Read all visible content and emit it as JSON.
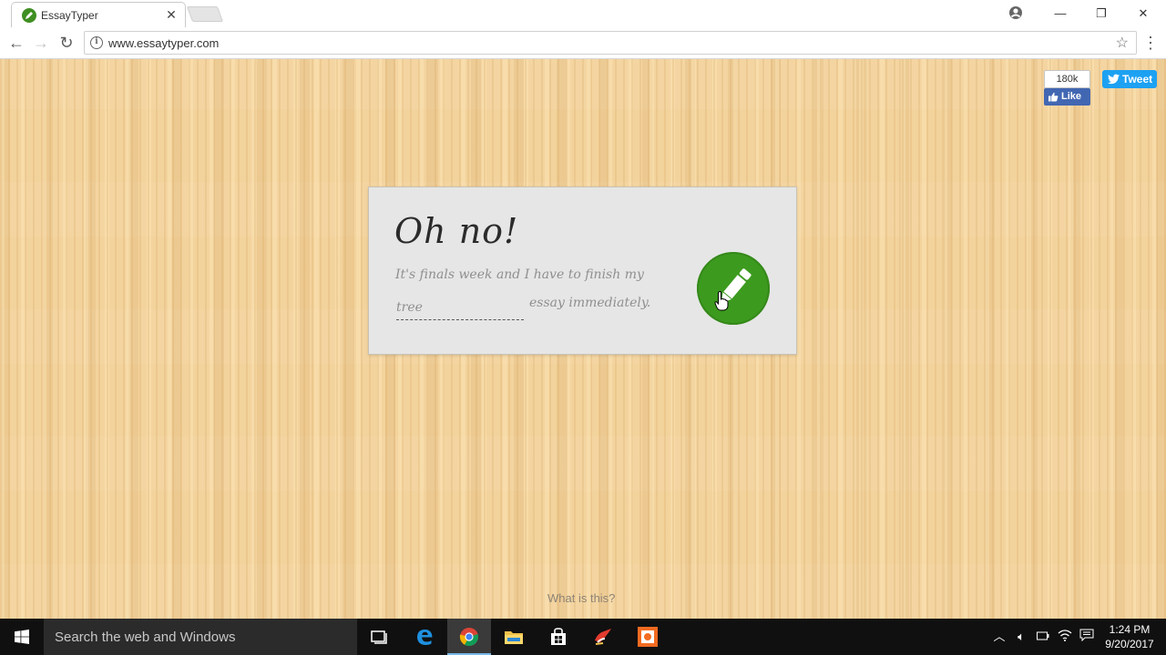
{
  "browser": {
    "tab_title": "EssayTyper",
    "tab_close": "✕",
    "url": "www.essaytyper.com",
    "window_controls": {
      "minimize": "—",
      "restore": "❐",
      "close": "✕"
    }
  },
  "social": {
    "like_count": "180k",
    "like_label": "Like",
    "tweet_label": "Tweet"
  },
  "card": {
    "title": "Oh no!",
    "line1": "It's finals week and I have to finish my",
    "topic_value": "tree",
    "line2": "essay immediately."
  },
  "footer": {
    "what_link": "What is this?"
  },
  "taskbar": {
    "search_placeholder": "Search the web and Windows",
    "clock_time": "1:24 PM",
    "clock_date": "9/20/2017"
  },
  "colors": {
    "accent_green": "#3c9a1e",
    "wood": "#f3d39c",
    "facebook_blue": "#4267b2",
    "twitter_blue": "#1da1f2"
  }
}
